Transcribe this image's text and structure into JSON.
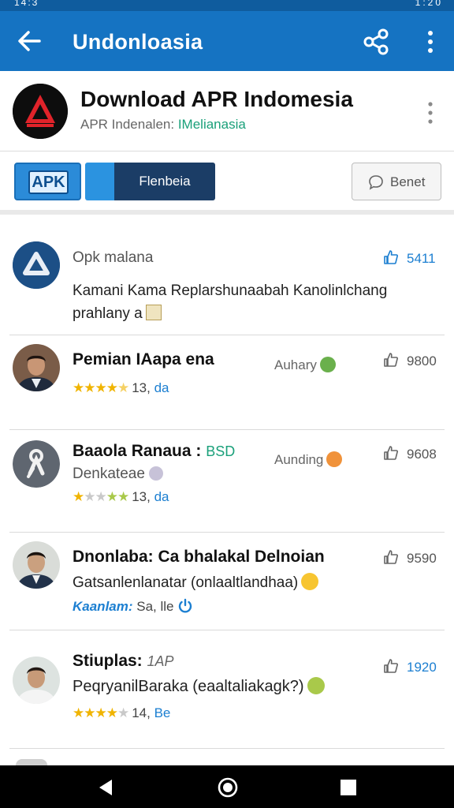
{
  "status_bar": {
    "left": "14:3",
    "right": "1:20"
  },
  "app_bar": {
    "title": "Undonloasia"
  },
  "header": {
    "name": "Download APR Indomesia",
    "sub_prefix": "APR Indenalen:",
    "sub_accent": "IMelianasia"
  },
  "buttons": {
    "apk_label": "APK",
    "segment_label": "Flenbeia",
    "benet_label": "Benet"
  },
  "items": [
    {
      "title": "Opk malana",
      "line2": "Kamani Kama Replarshunaabah Kanolinlchang",
      "line3": "prahlany a",
      "likes": "5411"
    },
    {
      "title": "Pemian IAapa ena",
      "tag": "Auhary",
      "rating_value": "13,",
      "rating_suffix": "da",
      "likes": "9800",
      "rating_stars": 4.5,
      "tag_color": "#6ab04c"
    },
    {
      "title": "Baaola Ranaua :",
      "title_badge": "BSD",
      "line2": "Denkateae",
      "tag": "Aunding",
      "rating_value": "13,",
      "rating_suffix": "da",
      "likes": "9608",
      "rating_stars": 1,
      "tag_color": "#f0923a"
    },
    {
      "title": "Dnonlaba: Ca bhalakal Delnoian",
      "line2": "Gatsanlenlanatar (onlaaltlandhaa)",
      "line3_accent": "Kaanlam:",
      "line3_rest": "Sa, lle",
      "likes": "9590"
    },
    {
      "title": "Stiuplas:",
      "title_extra": "1AP",
      "line2": "PeqryanilBaraka (eaaltaliakagk?)",
      "rating_value": "14,",
      "rating_suffix": "Be",
      "likes": "1920",
      "rating_stars": 4
    }
  ],
  "colors": {
    "app_bar": "#1573c2",
    "status_bar": "#0f5c9e",
    "accent_green": "#1aa07a",
    "link_blue": "#1c7fd1",
    "star": "#f0b400"
  },
  "icons": {
    "app_bar": [
      "back-arrow-icon",
      "share-icon",
      "more-vert-icon"
    ],
    "nav": [
      "nav-back-icon",
      "nav-home-icon",
      "nav-recents-icon"
    ]
  }
}
